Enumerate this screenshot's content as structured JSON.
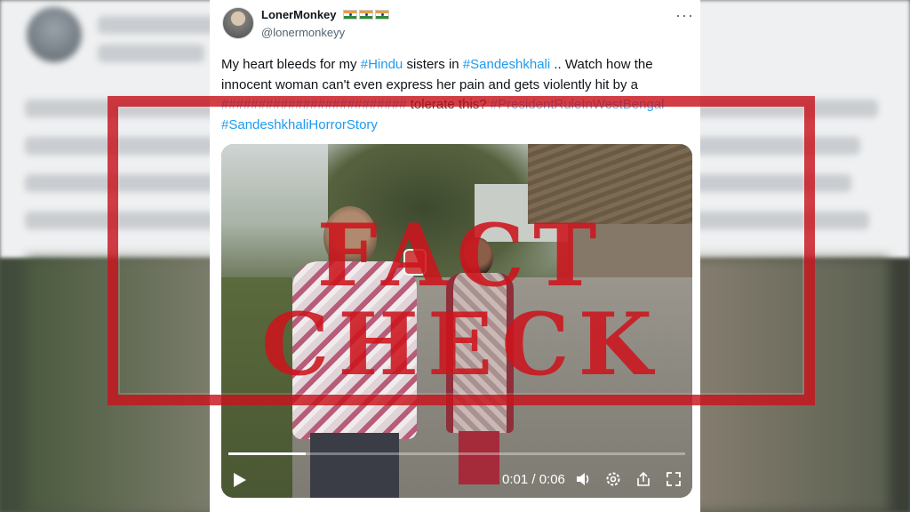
{
  "tweet": {
    "display_name": "LonerMonkey",
    "handle": "@lonermonkeyy",
    "text": {
      "part1": "My heart bleeds for my ",
      "tag_hindu": "#Hindu",
      "part2": " sisters in ",
      "tag_sandeshkhali": "#Sandeshkhali",
      "part3": " .. Watch how the innocent woman can't even express her  pain and gets violently hit by a ",
      "obscured": "#########################",
      "part4": " tolerate this? ",
      "tag_president": "#PresidentRuleInWestBengal",
      "tag_horror": "#SandeshkhaliHorrorStory"
    },
    "flags": [
      "india-flag-icon",
      "india-flag-icon",
      "india-flag-icon"
    ],
    "more_icon": "more-horizontal-icon"
  },
  "video": {
    "time": "0:01 / 0:06",
    "progress_fraction": 0.17,
    "controls": [
      "play-icon",
      "volume-icon",
      "settings-icon",
      "share-icon",
      "fullscreen-icon"
    ]
  },
  "stamp": {
    "text": "FACT CHECK",
    "color": "#cc141c"
  }
}
